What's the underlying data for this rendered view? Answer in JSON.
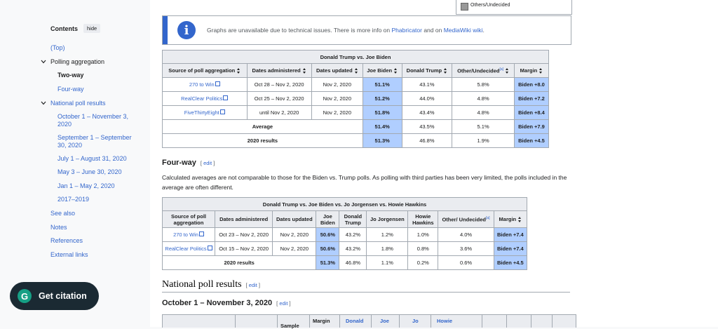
{
  "toc": {
    "title": "Contents",
    "hide": "hide",
    "items": [
      {
        "label": "(Top)"
      },
      {
        "label": "Polling aggregation"
      },
      {
        "label": "Two-way"
      },
      {
        "label": "Four-way"
      },
      {
        "label": "National poll results"
      },
      {
        "label": "October 1 – November 3, 2020"
      },
      {
        "label": "September 1 – September 30, 2020"
      },
      {
        "label": "July 1 – August 31, 2020"
      },
      {
        "label": "May 3 – June 30, 2020"
      },
      {
        "label": "Jan 1 – May 2, 2020"
      },
      {
        "label": "2017–2019"
      },
      {
        "label": "See also"
      },
      {
        "label": "Notes"
      },
      {
        "label": "References"
      },
      {
        "label": "External links"
      }
    ]
  },
  "citation": {
    "label": "Get citation",
    "logo": "G"
  },
  "legend_fragment": {
    "label": "Others/Undecided",
    "color": "#999999"
  },
  "notice": {
    "text_before": "Graphs are unavailable due to technical issues. There is more info on ",
    "link1": "Phabricator",
    "text_mid": " and on ",
    "link2": "MediaWiki wiki",
    "text_after": "."
  },
  "table1": {
    "caption": "Donald Trump vs. Joe Biden",
    "headers": [
      "Source of poll aggregation",
      "Dates administered",
      "Dates updated",
      "Joe Biden",
      "Donald Trump",
      "Other/Undecided",
      "Margin"
    ],
    "note_marker": "[a]",
    "rows": [
      {
        "source": "270 to Win",
        "admin": "Oct 28 – Nov 2, 2020",
        "updated": "Nov 2, 2020",
        "biden": "51.1%",
        "trump": "43.1%",
        "other": "5.8%",
        "margin": "Biden +8.0"
      },
      {
        "source": "RealClear Politics",
        "admin": "Oct 25 – Nov 2, 2020",
        "updated": "Nov 2, 2020",
        "biden": "51.2%",
        "trump": "44.0%",
        "other": "4.8%",
        "margin": "Biden +7.2"
      },
      {
        "source": "FiveThirtyEight",
        "admin": "until Nov 2, 2020",
        "updated": "Nov 2, 2020",
        "biden": "51.8%",
        "trump": "43.4%",
        "other": "4.8%",
        "margin": "Biden +8.4"
      }
    ],
    "summary": [
      {
        "label": "Average",
        "biden": "51.4%",
        "trump": "43.5%",
        "other": "5.1%",
        "margin": "Biden +7.9"
      },
      {
        "label": "2020 results",
        "biden": "51.3%",
        "trump": "46.8%",
        "other": "1.9%",
        "margin": "Biden +4.5"
      }
    ]
  },
  "fourway": {
    "heading": "Four-way",
    "edit": "edit",
    "paragraph": "Calculated averages are not comparable to those for the Biden vs. Trump polls. As polling with third parties has been very limited, the polls included in the average are often different."
  },
  "table2": {
    "caption": "Donald Trump vs. Joe Biden vs. Jo Jorgensen vs. Howie Hawkins",
    "headers": [
      "Source of poll aggregation",
      "Dates administered",
      "Dates updated",
      "Joe Biden",
      "Donald Trump",
      "Jo Jorgensen",
      "Howie Hawkins",
      "Other/ Undecided",
      "Margin"
    ],
    "note_marker": "[a]",
    "rows": [
      {
        "source": "270 to Win",
        "admin": "Oct 23 – Nov 2, 2020",
        "updated": "Nov 2, 2020",
        "biden": "50.6%",
        "trump": "43.2%",
        "jorgensen": "1.2%",
        "hawkins": "1.0%",
        "other": "4.0%",
        "margin": "Biden +7.4"
      },
      {
        "source": "RealClear Politics",
        "admin": "Oct 15 – Nov 2, 2020",
        "updated": "Nov 2, 2020",
        "biden": "50.6%",
        "trump": "43.2%",
        "jorgensen": "1.8%",
        "hawkins": "0.8%",
        "other": "3.6%",
        "margin": "Biden +7.4"
      }
    ],
    "summary": {
      "label": "2020 results",
      "biden": "51.3%",
      "trump": "46.8%",
      "jorgensen": "1.1%",
      "hawkins": "0.2%",
      "other": "0.6%",
      "margin": "Biden +4.5"
    }
  },
  "national": {
    "heading": "National poll results",
    "edit": "edit"
  },
  "october": {
    "heading": "October 1 – November 3, 2020",
    "edit": "edit"
  },
  "bottom_table": {
    "headers": [
      "Sample",
      "Margin",
      "Donald",
      "Joe",
      "Jo",
      "Howie"
    ]
  }
}
